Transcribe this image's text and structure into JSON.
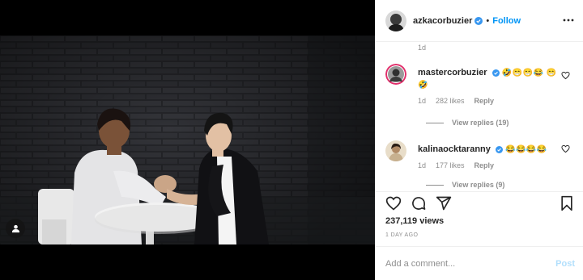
{
  "post": {
    "author": "azkacorbuzier",
    "follow_label": "Follow",
    "separator": "•"
  },
  "comments": {
    "previous_time": "1d",
    "items": [
      {
        "username": "mastercorbuzier",
        "text": "🤣😁😁😂 😁🤣",
        "time": "1d",
        "likes": "282 likes",
        "reply_label": "Reply",
        "view_replies": "View replies (19)"
      },
      {
        "username": "kalinaocktaranny",
        "text": "😂😂😂😂",
        "time": "1d",
        "likes": "177 likes",
        "reply_label": "Reply",
        "view_replies": "View replies (9)"
      }
    ]
  },
  "stats": {
    "views": "237,119 views",
    "date": "1 DAY AGO"
  },
  "composer": {
    "placeholder": "Add a comment...",
    "post_label": "Post"
  },
  "colors": {
    "link_blue": "#0095f6",
    "post_disabled": "#b2dffc",
    "muted": "#8e8e8e",
    "text": "#262626"
  },
  "icons": [
    "person-tag-icon",
    "verified-badge-icon",
    "more-options-icon",
    "heart-icon",
    "comment-icon",
    "share-icon",
    "bookmark-icon"
  ]
}
